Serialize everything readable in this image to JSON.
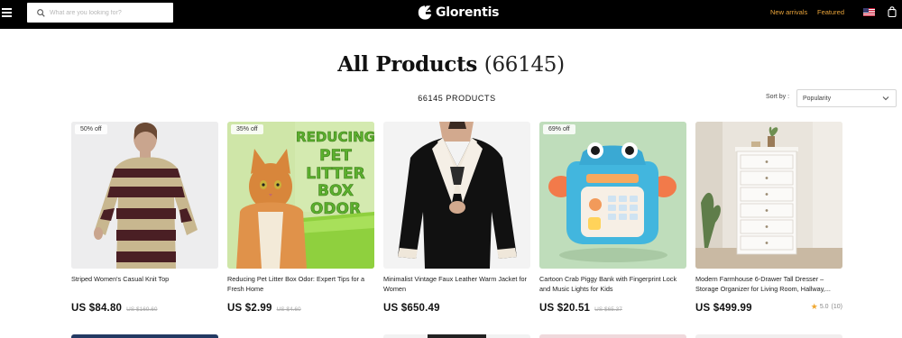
{
  "header": {
    "search_placeholder": "What are you looking for?",
    "brand": "Glorentis",
    "nav": {
      "new_arrivals": "New arrivals",
      "featured": "Featured"
    },
    "accent_color": "#e8a33a"
  },
  "page": {
    "title": "All Products",
    "title_count": "(66145)",
    "product_count_label": "66145 PRODUCTS",
    "sort": {
      "label": "Sort by :",
      "selected": "Popularity"
    }
  },
  "products": [
    {
      "badge": "50% off",
      "title": "Striped Women's Casual Knit Top",
      "price": "US $84.80",
      "old_price": "US $169.60",
      "icon": "striped-sweater-image"
    },
    {
      "badge": "35% off",
      "title": "Reducing Pet Litter Box Odor: Expert Tips for a Fresh Home",
      "price": "US $2.99",
      "old_price": "US $4.60",
      "icon": "cat-litter-box-image",
      "image_text": [
        "REDUCING",
        "PET",
        "LITTER",
        "BOX",
        "ODOR"
      ]
    },
    {
      "badge": "",
      "title": "Minimalist Vintage Faux Leather Warm Jacket for Women",
      "price": "US $650.49",
      "old_price": "",
      "icon": "leather-jacket-image"
    },
    {
      "badge": "69% off",
      "title": "Cartoon Crab Piggy Bank with Fingerprint Lock and Music Lights for Kids",
      "price": "US $20.51",
      "old_price": "US $65.37",
      "icon": "crab-piggy-bank-image"
    },
    {
      "badge": "",
      "title": "Modern Farmhouse 6-Drawer Tall Dresser – Storage Organizer for Living Room, Hallway,...",
      "price": "US $499.99",
      "old_price": "",
      "rating": "5.0",
      "reviews": "(10)",
      "icon": "white-dresser-image"
    }
  ]
}
